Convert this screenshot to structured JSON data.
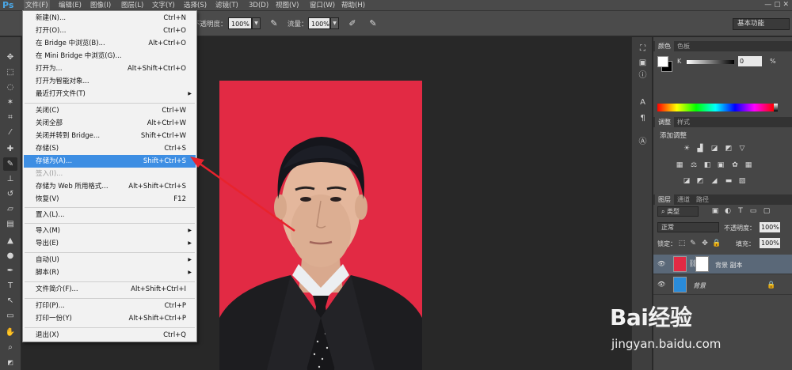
{
  "app": {
    "logo": "Ps"
  },
  "menubar": {
    "items": [
      "文件(F)",
      "编辑(E)",
      "图像(I)",
      "图层(L)",
      "文字(Y)",
      "选择(S)",
      "滤镜(T)",
      "3D(D)",
      "视图(V)",
      "窗口(W)",
      "帮助(H)"
    ],
    "window_controls": "— ▢ ✕"
  },
  "options_bar": {
    "opacity_label": "不透明度：",
    "opacity_value": "100%",
    "flow_label": "流量：",
    "flow_value": "100%",
    "workspace": "基本功能"
  },
  "file_menu": {
    "items": [
      {
        "label": "新建(N)...",
        "shortcut": "Ctrl+N"
      },
      {
        "label": "打开(O)...",
        "shortcut": "Ctrl+O"
      },
      {
        "label": "在 Bridge 中浏览(B)...",
        "shortcut": "Alt+Ctrl+O"
      },
      {
        "label": "在 Mini Bridge 中浏览(G)...",
        "shortcut": ""
      },
      {
        "label": "打开为...",
        "shortcut": "Alt+Shift+Ctrl+O"
      },
      {
        "label": "打开为智能对象...",
        "shortcut": ""
      },
      {
        "label": "最近打开文件(T)",
        "shortcut": "",
        "submenu": true
      },
      {
        "label": "关闭(C)",
        "shortcut": "Ctrl+W"
      },
      {
        "label": "关闭全部",
        "shortcut": "Alt+Ctrl+W"
      },
      {
        "label": "关闭并转到 Bridge...",
        "shortcut": "Shift+Ctrl+W"
      },
      {
        "label": "存储(S)",
        "shortcut": "Ctrl+S"
      },
      {
        "label": "存储为(A)...",
        "shortcut": "Shift+Ctrl+S",
        "highlighted": true
      },
      {
        "label": "签入(I)...",
        "shortcut": "",
        "disabled": true
      },
      {
        "label": "存储为 Web 所用格式...",
        "shortcut": "Alt+Shift+Ctrl+S"
      },
      {
        "label": "恢复(V)",
        "shortcut": "F12"
      },
      {
        "label": "置入(L)...",
        "shortcut": ""
      },
      {
        "label": "导入(M)",
        "shortcut": "",
        "submenu": true
      },
      {
        "label": "导出(E)",
        "shortcut": "",
        "submenu": true
      },
      {
        "label": "自动(U)",
        "shortcut": "",
        "submenu": true
      },
      {
        "label": "脚本(R)",
        "shortcut": "",
        "submenu": true
      },
      {
        "label": "文件简介(F)...",
        "shortcut": "Alt+Shift+Ctrl+I"
      },
      {
        "label": "打印(P)...",
        "shortcut": "Ctrl+P"
      },
      {
        "label": "打印一份(Y)",
        "shortcut": "Alt+Shift+Ctrl+P"
      },
      {
        "label": "退出(X)",
        "shortcut": "Ctrl+Q"
      }
    ]
  },
  "color_panel": {
    "tabs": [
      "颜色",
      "色板"
    ],
    "channel_label": "K",
    "channel_value": "0",
    "unit": "%"
  },
  "adjustments_panel": {
    "tabs": [
      "调整",
      "样式"
    ],
    "title": "添加调整"
  },
  "layers_panel": {
    "tabs": [
      "图层",
      "通道",
      "路径"
    ],
    "filter_label": "类型",
    "blend_mode": "正常",
    "opacity_label": "不透明度：",
    "opacity_value": "100%",
    "lock_label": "锁定：",
    "fill_label": "填充：",
    "fill_value": "100%",
    "layers": [
      {
        "name": "背景 副本",
        "selected": true,
        "has_mask": true
      },
      {
        "name": "背景",
        "selected": false,
        "locked": true
      }
    ]
  },
  "watermark": {
    "brand": "Bai经验",
    "url": "jingyan.baidu.com"
  },
  "colors": {
    "photo_background": "#e22a44",
    "menu_highlight": "#3d8ee3",
    "annotation_arrow": "#e8232d"
  }
}
